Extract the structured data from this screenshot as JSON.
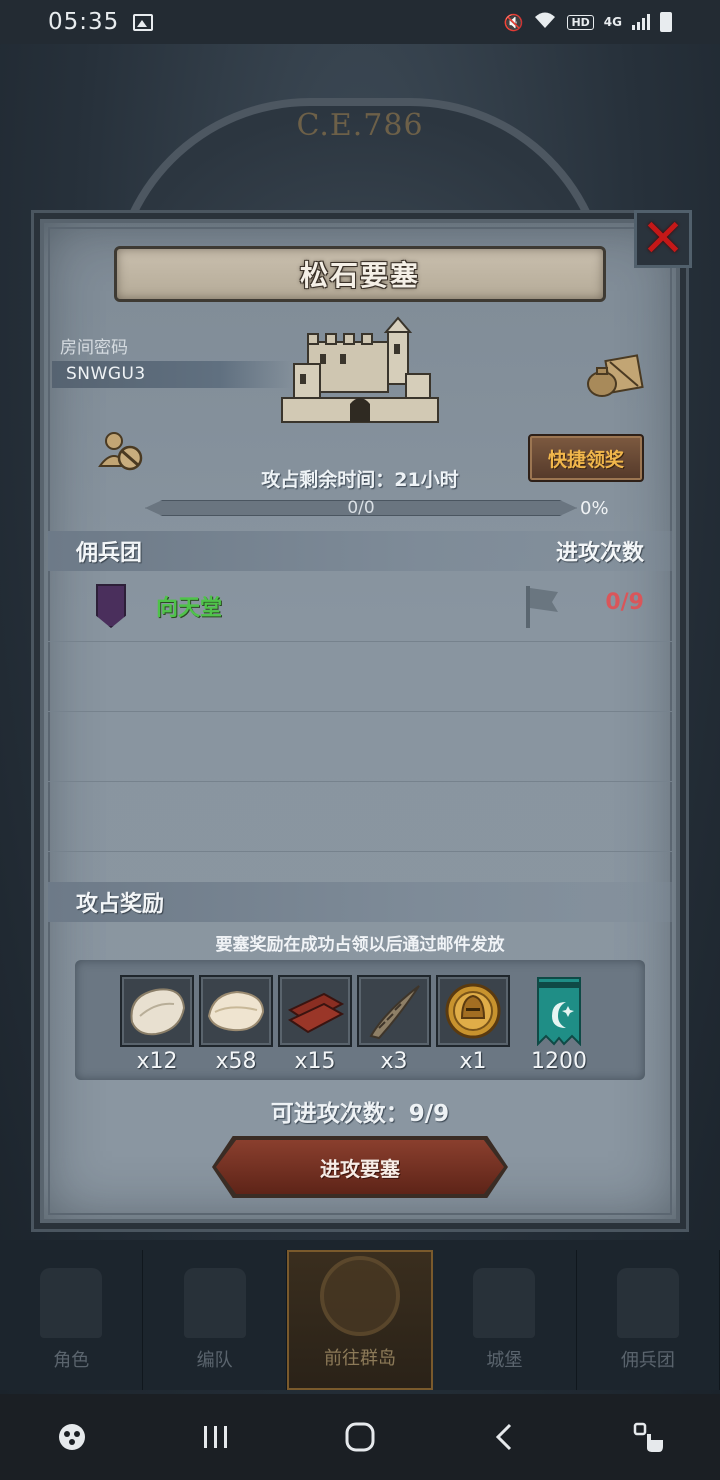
{
  "status_bar": {
    "time": "05:35",
    "hd": "HD",
    "network": "4G"
  },
  "background": {
    "dial_text": "C.E.786"
  },
  "dialog": {
    "title": "松石要塞",
    "room_password_label": "房间密码",
    "room_password": "SNWGU3",
    "quick_claim_label": "快捷领奖",
    "occupy_time": "攻占剩余时间：21小时",
    "progress": {
      "text": "0/0",
      "percent": "0%",
      "fill_fraction": 0
    },
    "mercenary_section": {
      "left": "佣兵团",
      "right": "进攻次数"
    },
    "guilds": [
      {
        "name": "向天堂",
        "attacks": "0/9",
        "shield_color": "#4a2f5c"
      }
    ],
    "reward_section": {
      "title": "攻占奖励",
      "note": "要塞奖励在成功占领以后通过邮件发放"
    },
    "rewards": [
      {
        "icon": "fur-pelt-icon",
        "count": "x12"
      },
      {
        "icon": "wool-icon",
        "count": "x58"
      },
      {
        "icon": "wood-planks-icon",
        "count": "x15"
      },
      {
        "icon": "horn-icon",
        "count": "x3"
      },
      {
        "icon": "gold-helmet-medal-icon",
        "count": "x1"
      },
      {
        "icon": "teal-banner-icon",
        "count": "1200"
      }
    ],
    "attacks_left": "可进攻次数：9/9",
    "attack_button": "进攻要塞"
  },
  "game_nav": [
    {
      "label": "角色",
      "active": false
    },
    {
      "label": "编队",
      "active": false
    },
    {
      "label": "前往群岛",
      "active": true
    },
    {
      "label": "城堡",
      "active": false
    },
    {
      "label": "佣兵团",
      "active": false
    }
  ],
  "colors": {
    "guild_name": "#4fc34a",
    "attack_count": "#d9565a",
    "quick_claim_text": "#f1b64b",
    "close_x": "#c41818"
  }
}
